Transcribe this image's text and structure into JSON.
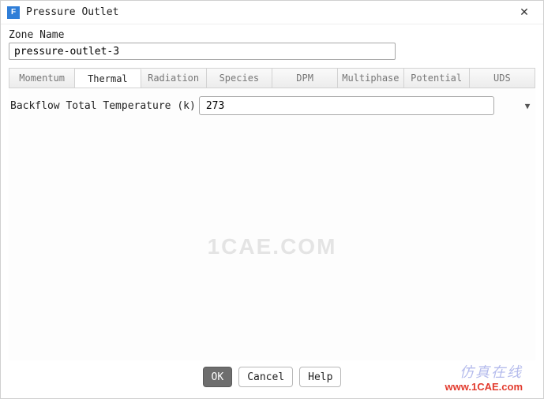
{
  "window": {
    "title": "Pressure Outlet",
    "icon_letter": "F"
  },
  "zone": {
    "label": "Zone Name",
    "value": "pressure-outlet-3"
  },
  "tabs": [
    {
      "id": "momentum",
      "label": "Momentum"
    },
    {
      "id": "thermal",
      "label": "Thermal"
    },
    {
      "id": "radiation",
      "label": "Radiation"
    },
    {
      "id": "species",
      "label": "Species"
    },
    {
      "id": "dpm",
      "label": "DPM"
    },
    {
      "id": "multiphase",
      "label": "Multiphase"
    },
    {
      "id": "potential",
      "label": "Potential"
    },
    {
      "id": "uds",
      "label": "UDS"
    }
  ],
  "active_tab": "thermal",
  "thermal": {
    "backflow_label": "Backflow Total Temperature (k)",
    "backflow_value": "273"
  },
  "buttons": {
    "ok": "OK",
    "cancel": "Cancel",
    "help": "Help"
  },
  "watermarks": {
    "center": "1CAE.COM",
    "cn": "仿真在线",
    "url": "www.1CAE.com"
  }
}
